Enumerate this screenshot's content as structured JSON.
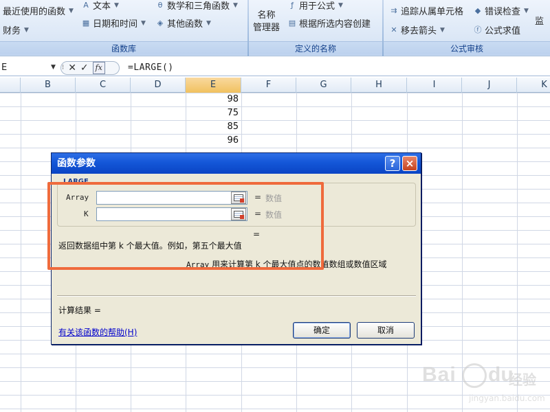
{
  "ribbon": {
    "function_library": {
      "label": "函数库",
      "recent": "最近使用的函数",
      "finance": "财务",
      "text": "文本",
      "datetime": "日期和时间",
      "math_trig": "数学和三角函数",
      "other_functions": "其他函数"
    },
    "defined_names": {
      "label": "定义的名称",
      "name_manager_line1": "名称",
      "name_manager_line2": "管理器",
      "use_in_formula": "用于公式",
      "create_from_selection": "根据所选内容创建"
    },
    "formula_auditing": {
      "label": "公式审核",
      "trace_dependents": "追踪从属单元格",
      "error_checking": "错误检查",
      "remove_arrows": "移去箭头",
      "evaluate_formula": "公式求值",
      "watch_window_partial": "监"
    }
  },
  "formula_bar": {
    "name_box": "E",
    "fx_label": "fx",
    "formula": "=LARGE()"
  },
  "sheet": {
    "columns": [
      "B",
      "C",
      "D",
      "E",
      "F",
      "G",
      "H",
      "I",
      "J",
      "K"
    ],
    "selected_column": "E",
    "values": [
      "98",
      "75",
      "85",
      "96"
    ]
  },
  "dialog": {
    "title": "函数参数",
    "help_btn": "?",
    "close_btn": "×",
    "function_name": "LARGE",
    "args": [
      {
        "name": "Array",
        "value": "",
        "eq": "=",
        "result": "数值"
      },
      {
        "name": "K",
        "value": "",
        "eq": "=",
        "result": "数值"
      }
    ],
    "result_eq": "=",
    "description": "返回数据组中第 k 个最大值。例如，第五个最大值",
    "arg_desc_name": "Array",
    "arg_desc_text": "用来计算第 k 个最大值点的数值数组或数值区域",
    "calc_result": "计算结果 =",
    "help_link": "有关该函数的帮助(H)",
    "ok": "确定",
    "cancel": "取消"
  },
  "colors": {
    "highlight": "#ef6a3c",
    "title_bar": "#1457d8",
    "ribbon_label": "#15428b",
    "selected_column": "#f1c15f"
  },
  "watermark": {
    "brand": "Bai",
    "brand_tail": "du",
    "cn": "经验",
    "url": "jingyan.baidu.com"
  }
}
